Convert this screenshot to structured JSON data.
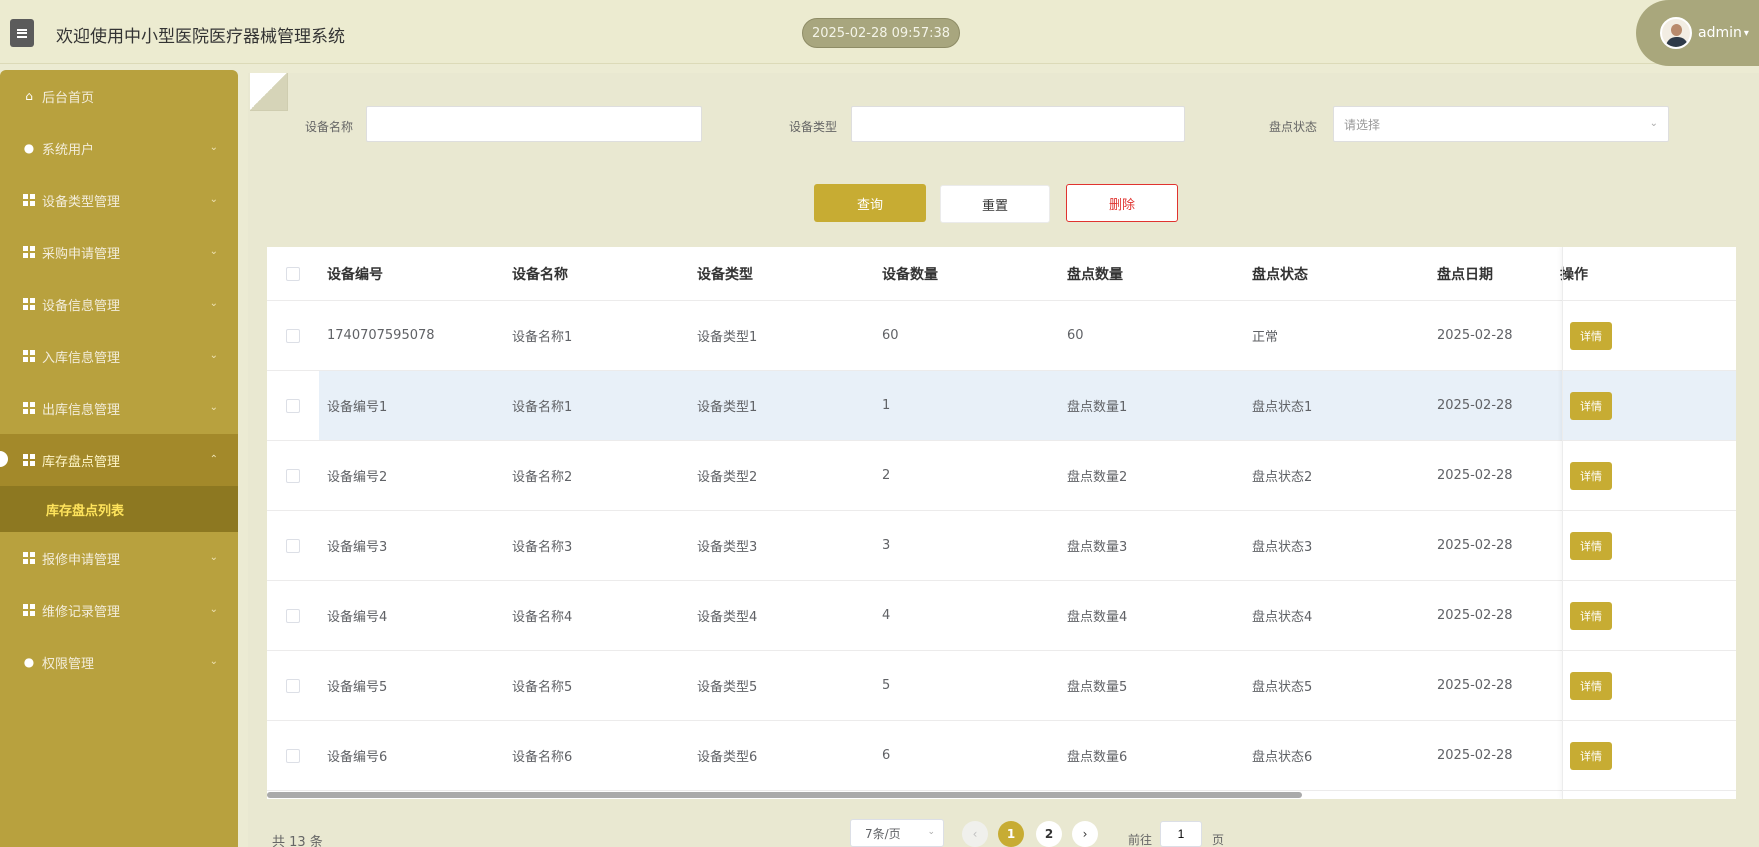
{
  "header": {
    "title": "欢迎使用中小型医院医疗器械管理系统",
    "datetime": "2025-02-28 09:57:38",
    "user": "admin"
  },
  "sidebar": {
    "items": [
      {
        "label": "后台首页",
        "icon": "home-icon"
      },
      {
        "label": "系统用户",
        "icon": "user-icon"
      },
      {
        "label": "设备类型管理",
        "icon": "grid-icon"
      },
      {
        "label": "采购申请管理",
        "icon": "grid-icon"
      },
      {
        "label": "设备信息管理",
        "icon": "grid-icon"
      },
      {
        "label": "入库信息管理",
        "icon": "grid-icon"
      },
      {
        "label": "出库信息管理",
        "icon": "grid-icon"
      },
      {
        "label": "库存盘点管理",
        "icon": "grid-icon",
        "active": true
      },
      {
        "label": "报修申请管理",
        "icon": "grid-icon"
      },
      {
        "label": "维修记录管理",
        "icon": "grid-icon"
      },
      {
        "label": "权限管理",
        "icon": "user-icon"
      }
    ],
    "sub_active": "库存盘点列表"
  },
  "search": {
    "name_label": "设备名称",
    "type_label": "设备类型",
    "status_label": "盘点状态",
    "status_placeholder": "请选择"
  },
  "buttons": {
    "query": "查询",
    "reset": "重置",
    "delete": "删除",
    "detail": "详情"
  },
  "table": {
    "columns": [
      "设备编号",
      "设备名称",
      "设备类型",
      "设备数量",
      "盘点数量",
      "盘点状态",
      "盘点日期",
      "操作"
    ],
    "rows": [
      [
        "1740707595078",
        "设备名称1",
        "设备类型1",
        "60",
        "60",
        "正常",
        "2025-02-28"
      ],
      [
        "设备编号1",
        "设备名称1",
        "设备类型1",
        "1",
        "盘点数量1",
        "盘点状态1",
        "2025-02-28"
      ],
      [
        "设备编号2",
        "设备名称2",
        "设备类型2",
        "2",
        "盘点数量2",
        "盘点状态2",
        "2025-02-28"
      ],
      [
        "设备编号3",
        "设备名称3",
        "设备类型3",
        "3",
        "盘点数量3",
        "盘点状态3",
        "2025-02-28"
      ],
      [
        "设备编号4",
        "设备名称4",
        "设备类型4",
        "4",
        "盘点数量4",
        "盘点状态4",
        "2025-02-28"
      ],
      [
        "设备编号5",
        "设备名称5",
        "设备类型5",
        "5",
        "盘点数量5",
        "盘点状态5",
        "2025-02-28"
      ],
      [
        "设备编号6",
        "设备名称6",
        "设备类型6",
        "6",
        "盘点数量6",
        "盘点状态6",
        "2025-02-28"
      ]
    ]
  },
  "pagination": {
    "total": "共 13 条",
    "page_size": "7条/页",
    "pages": [
      "1",
      "2"
    ],
    "goto_label": "前往",
    "goto_value": "1",
    "goto_unit": "页"
  },
  "colors": {
    "accent": "#c7ac33",
    "sidebar": "#b8a13e",
    "danger": "#e0332f"
  }
}
